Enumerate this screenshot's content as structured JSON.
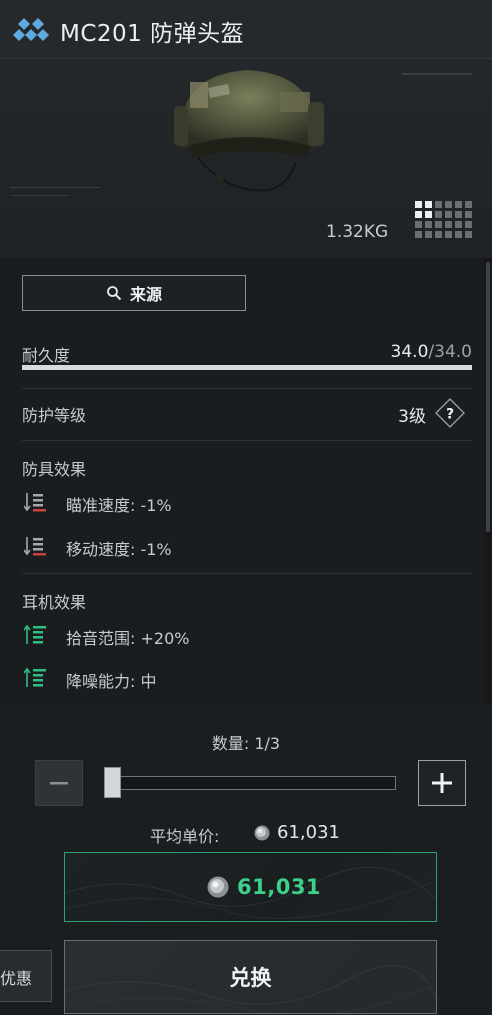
{
  "header": {
    "title": "MC201 防弹头盔",
    "logo_icon": "diamond-cluster-icon"
  },
  "item": {
    "weight": "1.32KG",
    "grid_icon": "grid-size-icon"
  },
  "source_button": {
    "label": "来源",
    "icon": "search-icon"
  },
  "durability": {
    "label": "耐久度",
    "current": "34.0",
    "max": "/34.0",
    "fraction": 1.0
  },
  "protection": {
    "label": "防护等级",
    "value": "3级",
    "help_icon": "question-icon"
  },
  "armor_effects": {
    "title": "防具效果",
    "items": [
      {
        "text": "瞄准速度: -1%",
        "icon": "stat-decrease-icon"
      },
      {
        "text": "移动速度: -1%",
        "icon": "stat-decrease-icon"
      }
    ]
  },
  "ear_effects": {
    "title": "耳机效果",
    "items": [
      {
        "text": "拾音范围: +20%",
        "icon": "stat-increase-icon"
      },
      {
        "text": "降噪能力: 中",
        "icon": "stat-increase-icon"
      }
    ]
  },
  "quantity": {
    "label": "数量: 1/3",
    "current": 1,
    "max": 3
  },
  "avg_price": {
    "label": "平均单价:",
    "value": "61,031"
  },
  "total_price": {
    "value": "61,031"
  },
  "discount_tab": {
    "label": "优惠"
  },
  "exchange_button": {
    "label": "兑换"
  },
  "colors": {
    "accent_green": "#3ecf88",
    "decrease_red": "#c7423f",
    "increase_green": "#2fbf7f"
  }
}
